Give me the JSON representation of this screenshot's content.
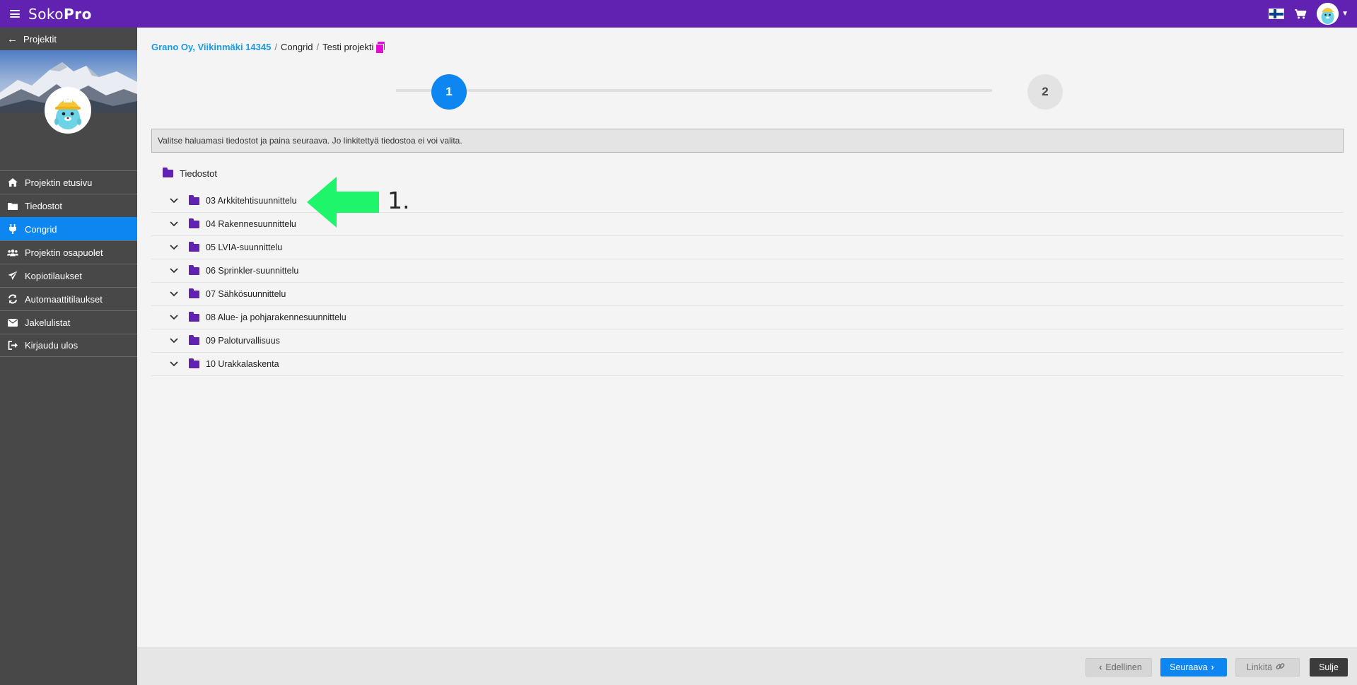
{
  "app": {
    "logo_light": "Soko",
    "logo_bold": "Pro"
  },
  "sidebar": {
    "back_label": "Projektit",
    "items": [
      {
        "label": "Projektin etusivu",
        "icon": "home-icon",
        "active": false
      },
      {
        "label": "Tiedostot",
        "icon": "folder-icon",
        "active": false
      },
      {
        "label": "Congrid",
        "icon": "plug-icon",
        "active": true
      },
      {
        "label": "Projektin osapuolet",
        "icon": "users-icon",
        "active": false
      },
      {
        "label": "Kopiotilaukset",
        "icon": "paper-plane-icon",
        "active": false
      },
      {
        "label": "Automaattitilaukset",
        "icon": "refresh-icon",
        "active": false
      },
      {
        "label": "Jakelulistat",
        "icon": "envelope-icon",
        "active": false
      },
      {
        "label": "Kirjaudu ulos",
        "icon": "sign-out-icon",
        "active": false
      }
    ]
  },
  "breadcrumb": {
    "company": "Grano Oy, Viikinmäki 14345",
    "section": "Congrid",
    "project": "Testi projekti"
  },
  "stepper": {
    "step1": "1",
    "step2": "2"
  },
  "notice": "Valitse haluamasi tiedostot ja paina seuraava. Jo linkitettyä tiedostoa ei voi valita.",
  "tree": {
    "root_label": "Tiedostot",
    "folders": [
      "03 Arkkitehtisuunnittelu",
      "04 Rakennesuunnittelu",
      "05 LVIA-suunnittelu",
      "06 Sprinkler-suunnittelu",
      "07 Sähkösuunnittelu",
      "08 Alue- ja pohjarakennesuunnittelu",
      "09 Paloturvallisuus",
      "10 Urakkalaskenta"
    ]
  },
  "annotation": {
    "label": "1.",
    "color": "#1ef56a"
  },
  "footer": {
    "prev": "Edellinen",
    "next": "Seuraava",
    "link": "Linkitä",
    "close": "Sulje"
  },
  "colors": {
    "brand_purple": "#6222b1",
    "accent_blue": "#0d86f2",
    "link_blue": "#1a9ae8",
    "copy_magenta": "#e80bd8"
  }
}
